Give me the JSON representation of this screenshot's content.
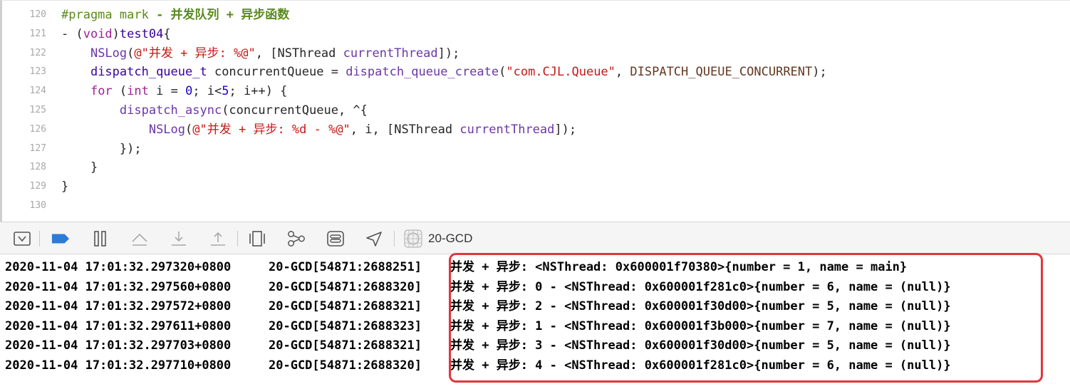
{
  "editor": {
    "lines": [
      {
        "n": "120",
        "parts": [
          [
            "mark",
            "#pragma mark "
          ],
          [
            "markb",
            "- 并发队列 + 异步函数"
          ]
        ]
      },
      {
        "n": "121",
        "parts": [
          [
            "p",
            "- ("
          ],
          [
            "kw",
            "void"
          ],
          [
            "p",
            ")"
          ],
          [
            "ty",
            "test04"
          ],
          [
            "p",
            "{"
          ]
        ]
      },
      {
        "n": "122",
        "parts": [
          [
            "p",
            "    "
          ],
          [
            "fn",
            "NSLog"
          ],
          [
            "p",
            "("
          ],
          [
            "str",
            "@\"并发 + 异步: %@\""
          ],
          [
            "p",
            ", [NSThread "
          ],
          [
            "fn",
            "currentThread"
          ],
          [
            "p",
            "]);"
          ]
        ]
      },
      {
        "n": "123",
        "parts": [
          [
            "p",
            "    "
          ],
          [
            "ty",
            "dispatch_queue_t"
          ],
          [
            "p",
            " concurrentQueue = "
          ],
          [
            "fn",
            "dispatch_queue_create"
          ],
          [
            "p",
            "("
          ],
          [
            "str",
            "\"com.CJL.Queue\""
          ],
          [
            "p",
            ", "
          ],
          [
            "mac",
            "DISPATCH_QUEUE_CONCURRENT"
          ],
          [
            "p",
            ");"
          ]
        ]
      },
      {
        "n": "124",
        "parts": [
          [
            "p",
            "    "
          ],
          [
            "kw",
            "for"
          ],
          [
            "p",
            " ("
          ],
          [
            "kw",
            "int"
          ],
          [
            "p",
            " i = "
          ],
          [
            "num",
            "0"
          ],
          [
            "p",
            "; i<"
          ],
          [
            "num",
            "5"
          ],
          [
            "p",
            "; i++) {"
          ]
        ]
      },
      {
        "n": "125",
        "parts": [
          [
            "p",
            "        "
          ],
          [
            "fn",
            "dispatch_async"
          ],
          [
            "p",
            "(concurrentQueue, ^{"
          ]
        ]
      },
      {
        "n": "126",
        "parts": [
          [
            "p",
            "            "
          ],
          [
            "fn",
            "NSLog"
          ],
          [
            "p",
            "("
          ],
          [
            "str",
            "@\"并发 + 异步: %d - %@\""
          ],
          [
            "p",
            ", i, [NSThread "
          ],
          [
            "fn",
            "currentThread"
          ],
          [
            "p",
            "]);"
          ]
        ]
      },
      {
        "n": "127",
        "parts": [
          [
            "p",
            "        });"
          ]
        ]
      },
      {
        "n": "128",
        "parts": [
          [
            "p",
            "    }"
          ]
        ]
      },
      {
        "n": "129",
        "parts": [
          [
            "p",
            "}"
          ]
        ]
      },
      {
        "n": "130",
        "parts": [
          [
            "p",
            ""
          ]
        ]
      }
    ]
  },
  "toolbar": {
    "target_label": "20-GCD",
    "buttons": [
      {
        "name": "hide-debug-area-button",
        "icon": "hide-area-icon"
      },
      {
        "name": "breakpoints-toggle-button",
        "icon": "breakpoint-icon"
      },
      {
        "name": "pause-button",
        "icon": "pause-icon"
      },
      {
        "name": "step-over-button",
        "icon": "step-over-icon"
      },
      {
        "name": "step-into-button",
        "icon": "step-into-icon"
      },
      {
        "name": "step-out-button",
        "icon": "step-out-icon"
      },
      {
        "name": "view-hierarchy-button",
        "icon": "view-hierarchy-icon"
      },
      {
        "name": "memory-graph-button",
        "icon": "memory-graph-icon"
      },
      {
        "name": "environment-overrides-button",
        "icon": "environment-overrides-icon"
      },
      {
        "name": "simulate-location-button",
        "icon": "location-icon"
      }
    ],
    "colors": {
      "breakpoint": "#2d7bd8"
    }
  },
  "console": {
    "highlight_color": "#e0363d",
    "lines": [
      {
        "ts": "2020-11-04 17:01:32.297320+0800",
        "proc": "20-GCD[54871:2688251]",
        "msg": "并发 + 异步: <NSThread: 0x600001f70380>{number = 1, name = main}"
      },
      {
        "ts": "2020-11-04 17:01:32.297560+0800",
        "proc": "20-GCD[54871:2688320]",
        "msg": "并发 + 异步: 0 - <NSThread: 0x600001f281c0>{number = 6, name = (null)}"
      },
      {
        "ts": "2020-11-04 17:01:32.297572+0800",
        "proc": "20-GCD[54871:2688321]",
        "msg": "并发 + 异步: 2 - <NSThread: 0x600001f30d00>{number = 5, name = (null)}"
      },
      {
        "ts": "2020-11-04 17:01:32.297611+0800",
        "proc": "20-GCD[54871:2688323]",
        "msg": "并发 + 异步: 1 - <NSThread: 0x600001f3b000>{number = 7, name = (null)}"
      },
      {
        "ts": "2020-11-04 17:01:32.297703+0800",
        "proc": "20-GCD[54871:2688321]",
        "msg": "并发 + 异步: 3 - <NSThread: 0x600001f30d00>{number = 5, name = (null)}"
      },
      {
        "ts": "2020-11-04 17:01:32.297710+0800",
        "proc": "20-GCD[54871:2688320]",
        "msg": "并发 + 异步: 4 - <NSThread: 0x600001f281c0>{number = 6, name = (null)}"
      }
    ]
  }
}
